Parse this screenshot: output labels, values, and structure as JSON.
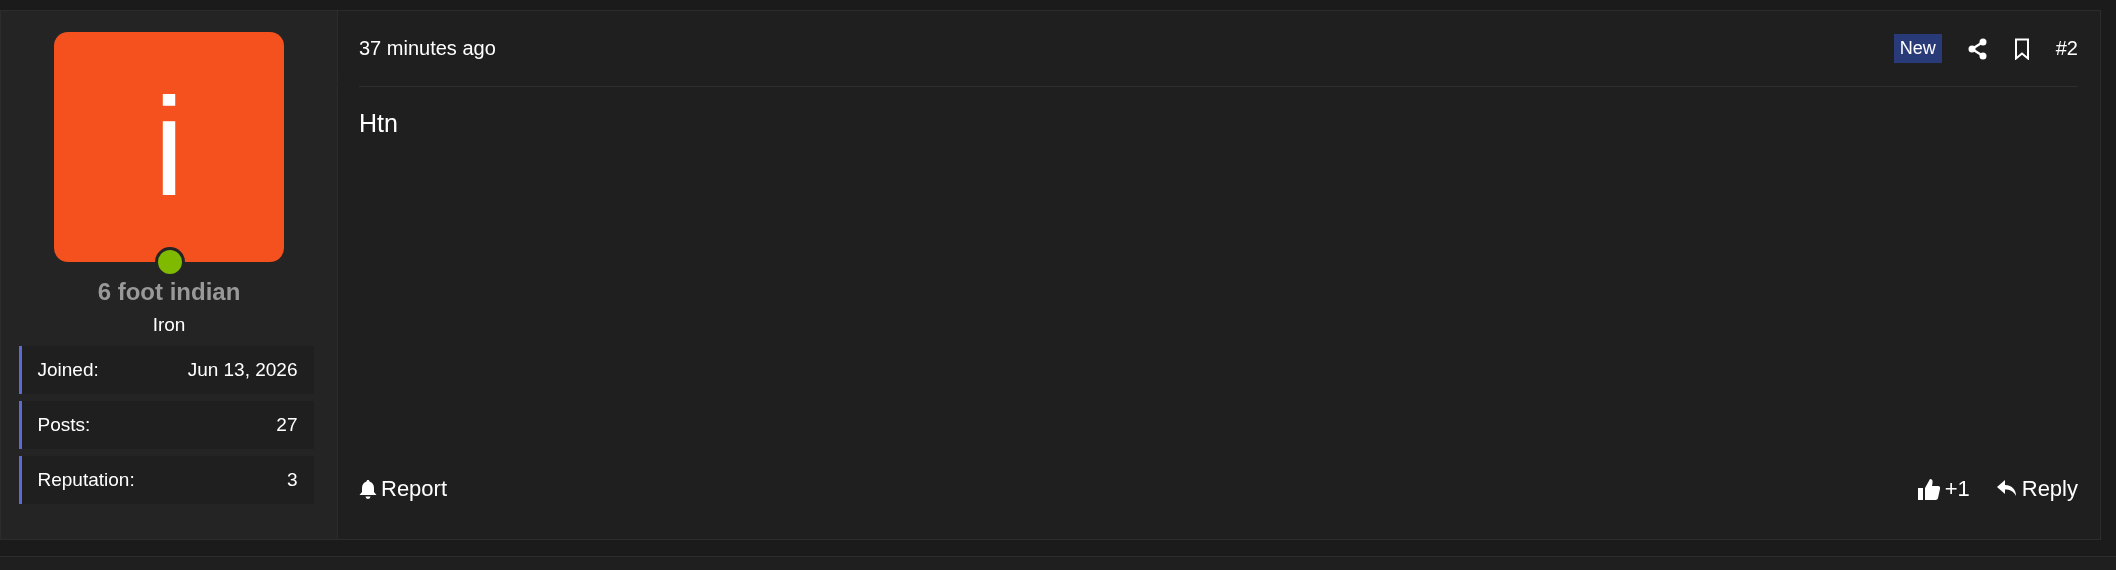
{
  "post": {
    "author": {
      "avatar_letter": "i",
      "online": true,
      "name": "6 foot indian",
      "title": "Iron",
      "stats": [
        {
          "label": "Joined:",
          "value": "Jun 13, 2026"
        },
        {
          "label": "Posts:",
          "value": "27"
        },
        {
          "label": "Reputation:",
          "value": "3"
        }
      ]
    },
    "time": "37 minutes ago",
    "badge": "New",
    "number": "#2",
    "body": "Htn",
    "actions": {
      "report": "Report",
      "like": "+1",
      "reply": "Reply"
    }
  }
}
